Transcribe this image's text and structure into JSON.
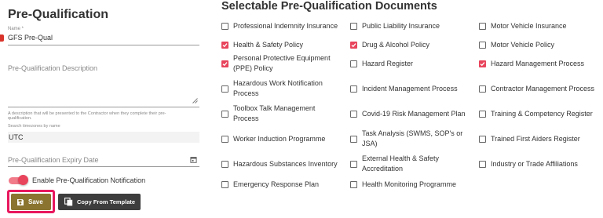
{
  "form": {
    "title": "Pre-Qualification",
    "name_label": "Name *",
    "name_value": "GFS Pre-Qual",
    "description_placeholder": "Pre-Qualification Description",
    "description_help": "A description that will be presented to the Contractor when they complete their pre-qualification.",
    "timezone_label": "Search timezones by name",
    "timezone_value": "UTC",
    "expiry_placeholder": "Pre-Qualification Expiry Date",
    "notification_label": "Enable Pre-Qualification Notification",
    "notification_enabled": true
  },
  "buttons": {
    "save_label": "Save",
    "copy_label": "Copy From Template"
  },
  "documents": {
    "title": "Selectable Pre-Qualification Documents",
    "items": [
      {
        "label": "Professional Indemnity Insurance",
        "checked": false
      },
      {
        "label": "Public Liability Insurance",
        "checked": false
      },
      {
        "label": "Motor Vehicle Insurance",
        "checked": false
      },
      {
        "label": "Health & Safety Policy",
        "checked": true
      },
      {
        "label": "Drug & Alcohol Policy",
        "checked": true
      },
      {
        "label": "Motor Vehicle Policy",
        "checked": false
      },
      {
        "label": "Personal Protective Equipment (PPE) Policy",
        "checked": true
      },
      {
        "label": "Hazard Register",
        "checked": false
      },
      {
        "label": "Hazard Management Process",
        "checked": true
      },
      {
        "label": "Hazardous Work Notification Process",
        "checked": false
      },
      {
        "label": "Incident Management Process",
        "checked": false
      },
      {
        "label": "Contractor Management Process",
        "checked": false
      },
      {
        "label": "Toolbox Talk Management Process",
        "checked": false
      },
      {
        "label": "Covid-19 Risk Management Plan",
        "checked": false
      },
      {
        "label": "Training & Competency Register",
        "checked": false
      },
      {
        "label": "Worker Induction Programme",
        "checked": false
      },
      {
        "label": "Task Analysis (SWMS, SOP's or JSA)",
        "checked": false
      },
      {
        "label": "Trained First Aiders Register",
        "checked": false
      },
      {
        "label": "Hazardous Substances Inventory",
        "checked": false
      },
      {
        "label": "External Health & Safety Accreditation",
        "checked": false
      },
      {
        "label": "Industry or Trade Affiliations",
        "checked": false
      },
      {
        "label": "Emergency Response Plan",
        "checked": false
      },
      {
        "label": "Health Monitoring Programme",
        "checked": false
      }
    ]
  },
  "colors": {
    "accent": "#e8445c",
    "save_button": "#8a7430",
    "copy_button": "#3d3d3d",
    "highlight": "#e8175d"
  },
  "icons": {
    "save": "floppy-disk-icon",
    "copy": "copy-icon",
    "calendar": "calendar-icon",
    "check": "checkmark-icon"
  }
}
